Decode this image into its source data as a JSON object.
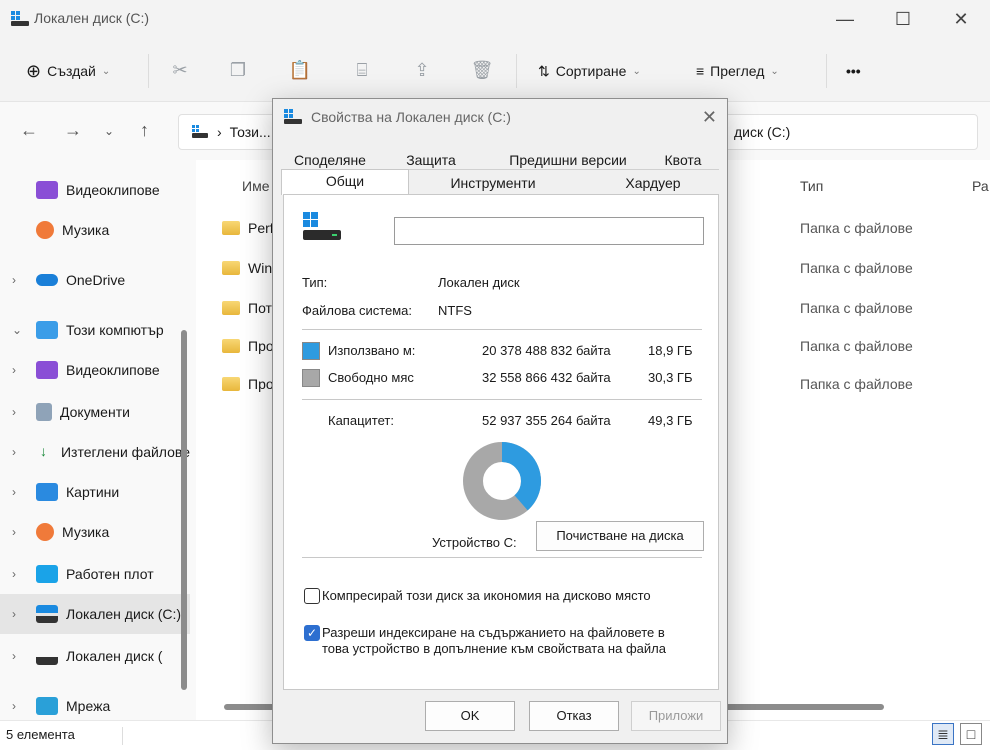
{
  "window": {
    "title": "Локален диск (C:)"
  },
  "toolbar": {
    "create": "Създай",
    "sort": "Сортиране",
    "view": "Преглед",
    "more": "•••"
  },
  "address": {
    "crumb": "Този...",
    "crumb_tail": "диск (C:)"
  },
  "sidebar": {
    "items": [
      {
        "label": "Видеоклипове"
      },
      {
        "label": "Музика"
      },
      {
        "label": "OneDrive"
      },
      {
        "label": "Този компютър"
      },
      {
        "label": "Видеоклипове"
      },
      {
        "label": "Документи"
      },
      {
        "label": "Изтеглени файлове"
      },
      {
        "label": "Картини"
      },
      {
        "label": "Музика"
      },
      {
        "label": "Работен плот"
      },
      {
        "label": "Локален диск (C:)"
      },
      {
        "label": "Локален диск ("
      },
      {
        "label": "Мрежа"
      }
    ]
  },
  "content": {
    "col_name": "Име",
    "col_type": "Тип",
    "col_size": "Ра",
    "rows": [
      {
        "name": "Perf",
        "type": "Папка с файлове"
      },
      {
        "name": "Win",
        "type": "Папка с файлове"
      },
      {
        "name": "Пот",
        "type": "Папка с файлове"
      },
      {
        "name": "Про",
        "type": "Папка с файлове"
      },
      {
        "name": "Про",
        "type": "Папка с файлове"
      }
    ]
  },
  "status": {
    "count": "5 елемента"
  },
  "dialog": {
    "title": "Свойства на Локален диск (C:)",
    "tabs_top": [
      "Споделяне",
      "Защита",
      "Предишни версии",
      "Квота"
    ],
    "tabs_bottom": [
      "Общи",
      "Инструменти",
      "Хардуер"
    ],
    "name_value": "",
    "type_label": "Тип:",
    "type_value": "Локален диск",
    "fs_label": "Файлова система:",
    "fs_value": "NTFS",
    "used_label": "Използвано м:",
    "used_bytes": "20 378 488 832 байта",
    "used_gb": "18,9 ГБ",
    "free_label": "Свободно мяс",
    "free_bytes": "32 558 866 432 байта",
    "free_gb": "30,3 ГБ",
    "cap_label": "Капацитет:",
    "cap_bytes": "52 937 355 264 байта",
    "cap_gb": "49,3 ГБ",
    "used_fraction": 0.385,
    "used_color": "#2e9be0",
    "free_color": "#a8a8a8",
    "device_label": "Устройство C:",
    "cleanup": "Почистване на диска",
    "compress": "Компресирай този диск за икономия на дисково място",
    "index_line1": "Разреши индексиране на съдържанието на файловете в",
    "index_line2": "това устройство в допълнение към свойствата на файла",
    "compress_checked": false,
    "index_checked": true,
    "ok": "OK",
    "cancel": "Отказ",
    "apply": "Приложи"
  }
}
